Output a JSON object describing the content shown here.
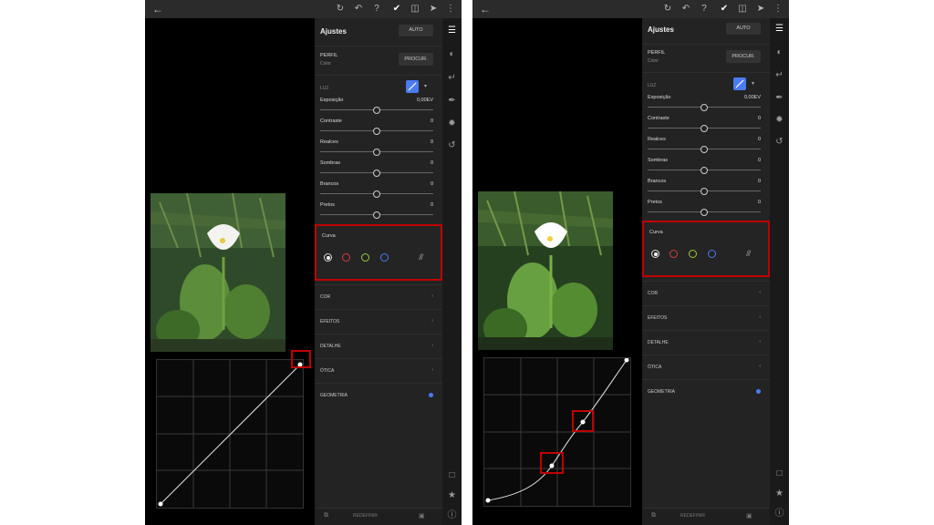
{
  "screens": [
    {
      "topbar": {
        "icons": [
          "back-arrow-icon",
          "redo-icon",
          "undo-icon",
          "help-icon",
          "check-icon",
          "compare-icon",
          "share-icon",
          "more-icon"
        ]
      },
      "panel": {
        "title": "Ajustes",
        "auto_label": "AUTO",
        "profile_label": "PERFIL",
        "profile_value": "Color",
        "browse_label": "PROCUR.",
        "light_label": "LUZ",
        "sliders": [
          {
            "label": "Exposição",
            "value": "0,00EV",
            "level": 0.5
          },
          {
            "label": "Contraste",
            "value": "0",
            "level": 0.5
          },
          {
            "label": "Realces",
            "value": "0",
            "level": 0.5
          },
          {
            "label": "Sombras",
            "value": "0",
            "level": 0.5
          },
          {
            "label": "Brancos",
            "value": "0",
            "level": 0.5
          },
          {
            "label": "Pretos",
            "value": "0",
            "level": 0.5
          }
        ],
        "curve_label": "Curva",
        "sections": [
          {
            "label": "COR",
            "kind": "arrow",
            "symbol": "‹"
          },
          {
            "label": "EFEITOS",
            "kind": "arrow",
            "symbol": "‹"
          },
          {
            "label": "DETALHE",
            "kind": "arrow",
            "symbol": "‹"
          },
          {
            "label": "ÓTICA",
            "kind": "arrow",
            "symbol": "‹"
          },
          {
            "label": "GEOMETRIA",
            "kind": "dot",
            "symbol": ""
          }
        ],
        "reset_label": "REDEFINIR"
      },
      "curve": {
        "type": "linear"
      }
    },
    {
      "topbar": {
        "icons": [
          "back-arrow-icon",
          "redo-icon",
          "undo-icon",
          "help-icon",
          "check-icon",
          "compare-icon",
          "share-icon",
          "more-icon"
        ]
      },
      "panel": {
        "title": "Ajustes",
        "auto_label": "AUTO",
        "profile_label": "PERFIL",
        "profile_value": "Color",
        "browse_label": "PROCUR.",
        "light_label": "LUZ",
        "sliders": [
          {
            "label": "Exposição",
            "value": "0,00EV",
            "level": 0.5
          },
          {
            "label": "Contraste",
            "value": "0",
            "level": 0.5
          },
          {
            "label": "Realces",
            "value": "0",
            "level": 0.5
          },
          {
            "label": "Sombras",
            "value": "0",
            "level": 0.5
          },
          {
            "label": "Brancos",
            "value": "0",
            "level": 0.5
          },
          {
            "label": "Pretos",
            "value": "0",
            "level": 0.5
          }
        ],
        "curve_label": "Curva",
        "sections": [
          {
            "label": "COR",
            "kind": "arrow",
            "symbol": "‹"
          },
          {
            "label": "EFEITOS",
            "kind": "arrow",
            "symbol": "‹"
          },
          {
            "label": "DETALHE",
            "kind": "arrow",
            "symbol": "‹"
          },
          {
            "label": "ÓTICA",
            "kind": "arrow",
            "symbol": "‹"
          },
          {
            "label": "GEOMETRIA",
            "kind": "dot",
            "symbol": ""
          }
        ],
        "reset_label": "REDEFINIR"
      },
      "curve": {
        "type": "s-curve"
      }
    }
  ],
  "colors": {
    "highlight": "#c00000",
    "accent": "#4a7cf0",
    "channel_white": "#dddddd",
    "channel_red": "#d23b3b",
    "channel_green": "#9ccc3d",
    "channel_blue": "#4a7cf0"
  }
}
